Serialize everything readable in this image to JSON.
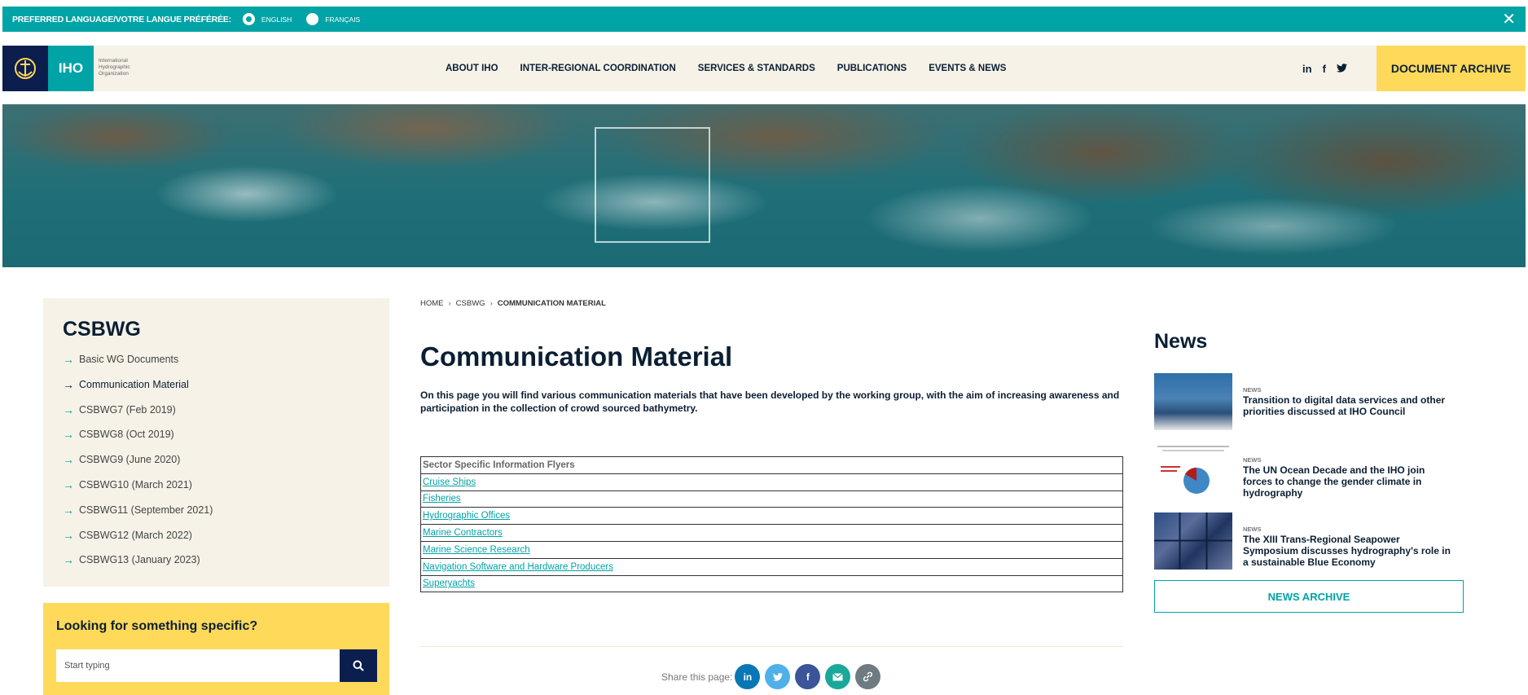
{
  "lang_bar": {
    "label": "PREFERRED LANGUAGE/VOTRE LANGUE PRÉFÉRÉE:",
    "options": [
      "ENGLISH",
      "FRANÇAIS"
    ],
    "selected": "ENGLISH",
    "close": "✕"
  },
  "header": {
    "logo_abbr": "IHO",
    "logo_text": "International Hydrographic Organization",
    "nav": [
      "ABOUT IHO",
      "INTER-REGIONAL COORDINATION",
      "SERVICES & STANDARDS",
      "PUBLICATIONS",
      "EVENTS & NEWS"
    ],
    "social": {
      "linkedin": "in",
      "facebook": "f"
    },
    "document_archive": "DOCUMENT ARCHIVE"
  },
  "sidebar": {
    "title": "CSBWG",
    "items": [
      "Basic WG Documents",
      "Communication Material",
      "CSBWG7 (Feb 2019)",
      "CSBWG8 (Oct 2019)",
      "CSBWG9 (June 2020)",
      "CSBWG10 (March 2021)",
      "CSBWG11 (September 2021)",
      "CSBWG12 (March 2022)",
      "CSBWG13 (January 2023)"
    ],
    "active": "Communication Material"
  },
  "search": {
    "question": "Looking for something specific?",
    "placeholder": "Start typing"
  },
  "breadcrumb": {
    "home": "HOME",
    "section": "CSBWG",
    "current": "COMMUNICATION MATERIAL"
  },
  "main": {
    "title": "Communication Material",
    "intro": "On this page you will find various communication materials that have been developed by the working group, with the aim of increasing awareness and participation in the collection of crowd sourced bathymetry.",
    "table_header": "Sector Specific Information Flyers",
    "flyers": [
      "Cruise Ships",
      "Fisheries",
      "Hydrographic Offices",
      "Marine Contractors",
      "Marine Science Research",
      "Navigation Software and Hardware Producers",
      "Superyachts"
    ]
  },
  "share": {
    "label": "Share this page:"
  },
  "news": {
    "title": "News",
    "items": [
      {
        "tag": "NEWS",
        "headline": "Transition to digital data services and other priorities discussed at IHO Council"
      },
      {
        "tag": "NEWS",
        "headline": "The UN Ocean Decade and the IHO join forces to change the gender climate in hydrography"
      },
      {
        "tag": "NEWS",
        "headline": "The XIII Trans-Regional Seapower Symposium discusses hydrography's role in a sustainable Blue Economy"
      }
    ],
    "archive": "NEWS ARCHIVE"
  },
  "colors": {
    "teal": "#00a3a6",
    "navy": "#0b1e4e",
    "yellow": "#ffd95a",
    "cream": "#f6f2e8"
  }
}
